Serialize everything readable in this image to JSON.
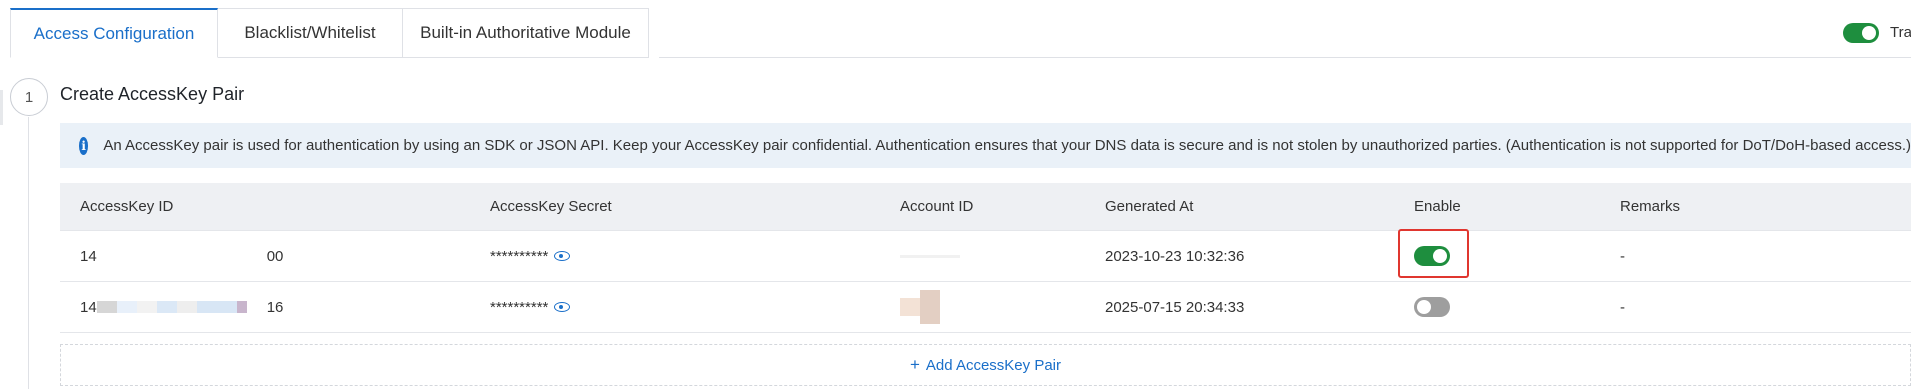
{
  "tabs": [
    {
      "label": "Access Configuration",
      "active": true
    },
    {
      "label": "Blacklist/Whitelist",
      "active": false
    },
    {
      "label": "Built-in Authoritative Module",
      "active": false
    }
  ],
  "top_right": {
    "toggle_on": true,
    "label": "Tra"
  },
  "step": {
    "number": "1",
    "title": "Create AccessKey Pair"
  },
  "alert": {
    "icon": "info-icon",
    "text": "An AccessKey pair is used for authentication by using an SDK or JSON API. Keep your AccessKey pair confidential. Authentication ensures that your DNS data is secure and is not stolen by unauthorized parties. (Authentication is not supported for DoT/DoH-based access.)"
  },
  "table": {
    "headers": [
      "AccessKey ID",
      "AccessKey Secret",
      "Account ID",
      "Generated At",
      "Enable",
      "Remarks"
    ],
    "rows": [
      {
        "id_start": "14",
        "id_end": "00",
        "secret": "**********",
        "account": "",
        "generated": "2023-10-23 10:32:36",
        "enabled": true,
        "remarks": "-"
      },
      {
        "id_start": "14",
        "id_end": "16",
        "secret": "**********",
        "account": "",
        "generated": "2025-07-15 20:34:33",
        "enabled": false,
        "remarks": "-"
      }
    ]
  },
  "add_button": {
    "label": "Add AccessKey Pair"
  },
  "colors": {
    "accent": "#1a6fc9",
    "toggle_on": "#1e8e3e",
    "toggle_off": "#9e9e9e",
    "highlight": "#e0362f",
    "alert_bg": "#eaf1f8"
  }
}
